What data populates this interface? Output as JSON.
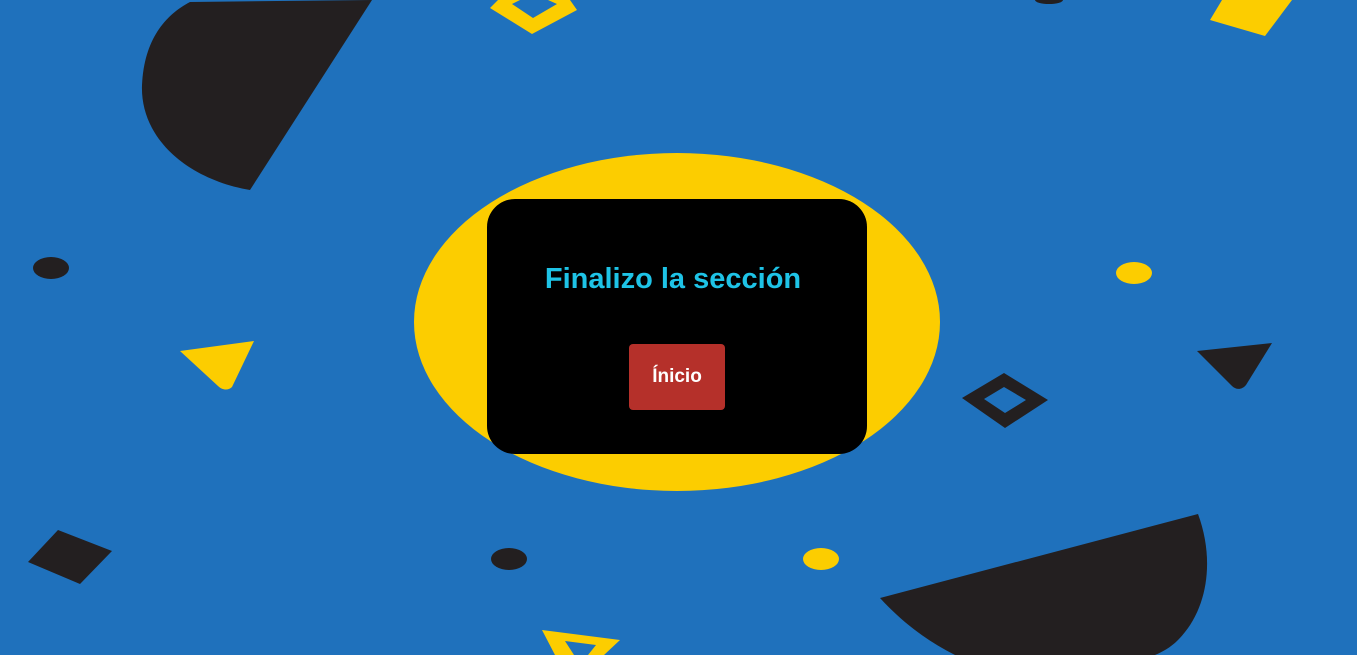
{
  "colors": {
    "background": "#1f71bc",
    "accent_yellow": "#fccd00",
    "shape_dark": "#231f20",
    "card_background": "#000000",
    "title_color": "#1ec3e6",
    "button_background": "#b5302a",
    "button_text": "#ffffff"
  },
  "card": {
    "title": "Finalizo la sección",
    "button_label": "Ínicio"
  },
  "decorations": [
    "dark-half-circle-shape",
    "yellow-diamond-outline-shape",
    "yellow-square-shape",
    "dark-dot-shape",
    "yellow-dot-shape",
    "yellow-triangle-shape",
    "dark-triangle-shape",
    "dark-diamond-outline-shape",
    "dark-square-shape",
    "yellow-triangle-outline-shape",
    "yellow-ellipse-backdrop"
  ]
}
